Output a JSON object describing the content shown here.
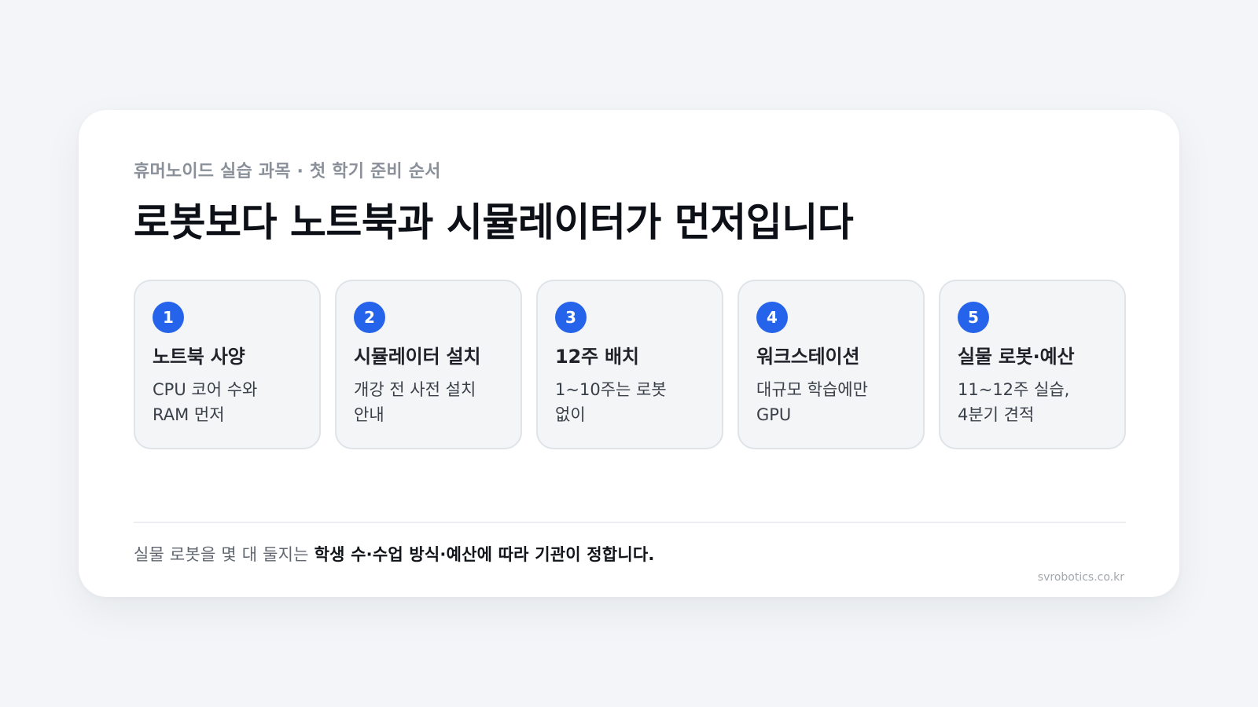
{
  "header": {
    "eyebrow": "휴머노이드 실습 과목 · 첫 학기 준비 순서",
    "title": "로봇보다 노트북과 시뮬레이터가 먼저입니다"
  },
  "steps": [
    {
      "number": "1",
      "title": "노트북 사양",
      "description": "CPU 코어 수와 RAM 먼저"
    },
    {
      "number": "2",
      "title": "시뮬레이터 설치",
      "description": "개강 전 사전 설치 안내"
    },
    {
      "number": "3",
      "title": "12주 배치",
      "description": "1~10주는 로봇 없이"
    },
    {
      "number": "4",
      "title": "워크스테이션",
      "description": "대규모 학습에만 GPU"
    },
    {
      "number": "5",
      "title": "실물 로봇·예산",
      "description": "11~12주 실습, 4분기 견적"
    }
  ],
  "footer": {
    "lead": "실물 로봇을 몇 대 둘지는 ",
    "emphasis": "학생 수·수업 방식·예산에 따라 기관이 정합니다.",
    "source": "svrobotics.co.kr"
  },
  "colors": {
    "accent": "#2563eb",
    "background": "#f3f5f8",
    "card": "#ffffff"
  }
}
